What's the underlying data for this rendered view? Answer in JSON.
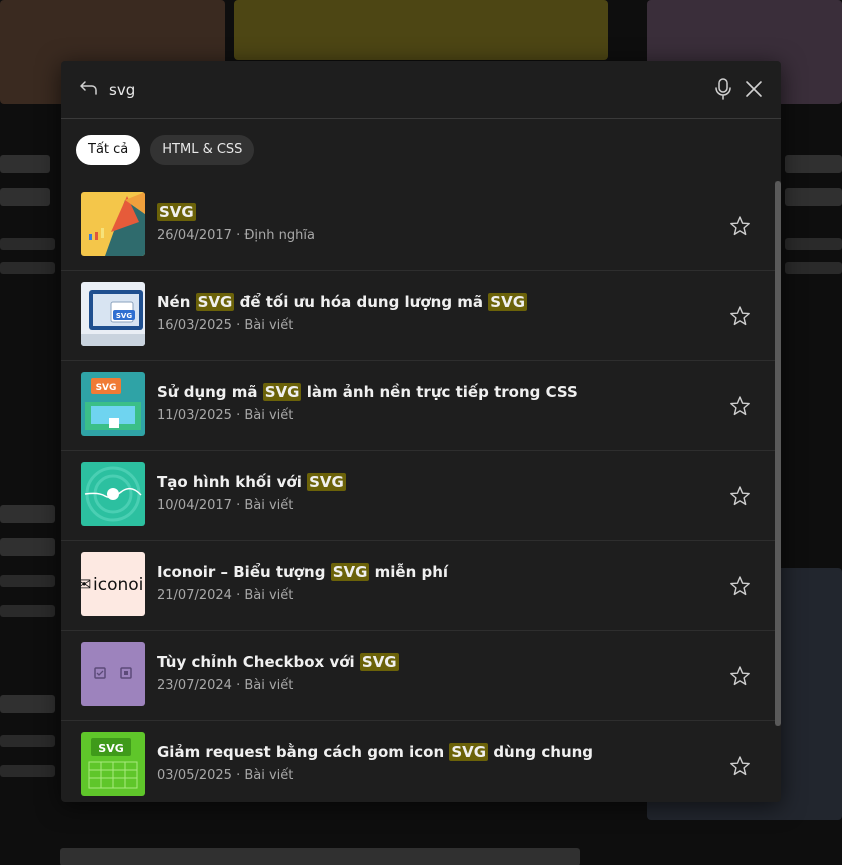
{
  "search": {
    "query": "svg"
  },
  "filters": [
    {
      "label": "Tất cả",
      "active": true
    },
    {
      "label": "HTML & CSS",
      "active": false
    }
  ],
  "results": [
    {
      "title_parts": [
        {
          "text": "SVG",
          "highlight": true
        }
      ],
      "date": "26/04/2017",
      "category": "Định nghĩa",
      "thumb": "svg-definition"
    },
    {
      "title_parts": [
        {
          "text": "Nén ",
          "highlight": false
        },
        {
          "text": "SVG",
          "highlight": true
        },
        {
          "text": " để tối ưu hóa dung lượng mã ",
          "highlight": false
        },
        {
          "text": "SVG",
          "highlight": true
        }
      ],
      "date": "16/03/2025",
      "category": "Bài viết",
      "thumb": "svg-compress"
    },
    {
      "title_parts": [
        {
          "text": "Sử dụng mã ",
          "highlight": false
        },
        {
          "text": "SVG",
          "highlight": true
        },
        {
          "text": " làm ảnh nền trực tiếp trong CSS",
          "highlight": false
        }
      ],
      "date": "11/03/2025",
      "category": "Bài viết",
      "thumb": "svg-background"
    },
    {
      "title_parts": [
        {
          "text": "Tạo hình khối với ",
          "highlight": false
        },
        {
          "text": "SVG",
          "highlight": true
        }
      ],
      "date": "10/04/2017",
      "category": "Bài viết",
      "thumb": "svg-shapes"
    },
    {
      "title_parts": [
        {
          "text": "Iconoir – Biểu tượng ",
          "highlight": false
        },
        {
          "text": "SVG",
          "highlight": true
        },
        {
          "text": " miễn phí",
          "highlight": false
        }
      ],
      "date": "21/07/2024",
      "category": "Bài viết",
      "thumb": "iconoir-logo",
      "thumb_text": "iconoi"
    },
    {
      "title_parts": [
        {
          "text": "Tùy chỉnh Checkbox với ",
          "highlight": false
        },
        {
          "text": "SVG",
          "highlight": true
        }
      ],
      "date": "23/07/2024",
      "category": "Bài viết",
      "thumb": "checkbox"
    },
    {
      "title_parts": [
        {
          "text": "Giảm request bằng cách gom icon ",
          "highlight": false
        },
        {
          "text": "SVG",
          "highlight": true
        },
        {
          "text": " dùng chung",
          "highlight": false
        }
      ],
      "date": "03/05/2025",
      "category": "Bài viết",
      "thumb": "svg-sprite"
    }
  ],
  "meta_separator": " · ",
  "thumb_label": "SVG",
  "colors": {
    "highlight": "#6b6209",
    "panel": "#1e1e1e",
    "chip_active": "#ffffff"
  },
  "icons": {
    "back": "back-arrow-icon",
    "mic": "microphone-icon",
    "close": "close-icon",
    "favorite": "star-outline-icon"
  }
}
